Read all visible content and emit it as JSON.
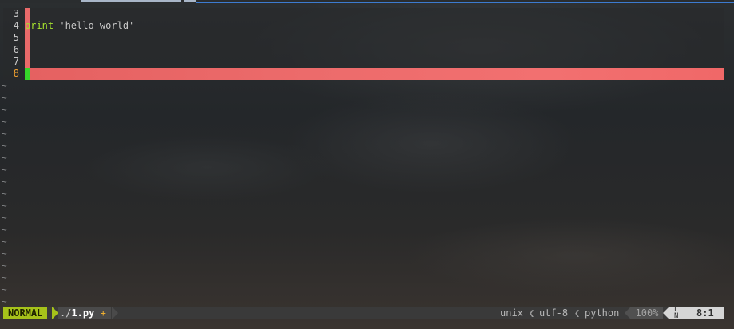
{
  "editor": {
    "lines": [
      {
        "number": "3",
        "text": ""
      },
      {
        "number": "4",
        "keyword": "print",
        "string": " 'hello world'"
      },
      {
        "number": "5",
        "text": ""
      },
      {
        "number": "6",
        "text": ""
      },
      {
        "number": "7",
        "text": ""
      },
      {
        "number": "8",
        "text": ""
      }
    ],
    "empty_marker": "~",
    "colors": {
      "marker": "#e96a6a",
      "cursorline": "#f07070",
      "cursor": "#35d62a",
      "current_line_number": "#f0a030",
      "keyword": "#a6e22e"
    }
  },
  "statusline": {
    "mode": "NORMAL",
    "file_dir": "./",
    "file_name": "1.py",
    "modified": "+",
    "fileformat": "unix",
    "encoding": "utf-8",
    "filetype": "python",
    "percent": "100%",
    "ln_icon_top": "L",
    "ln_icon_bottom": "N",
    "position": "8:1",
    "colors": {
      "mode_bg": "#a6c21a",
      "position_bg": "#d6d6d6"
    }
  }
}
